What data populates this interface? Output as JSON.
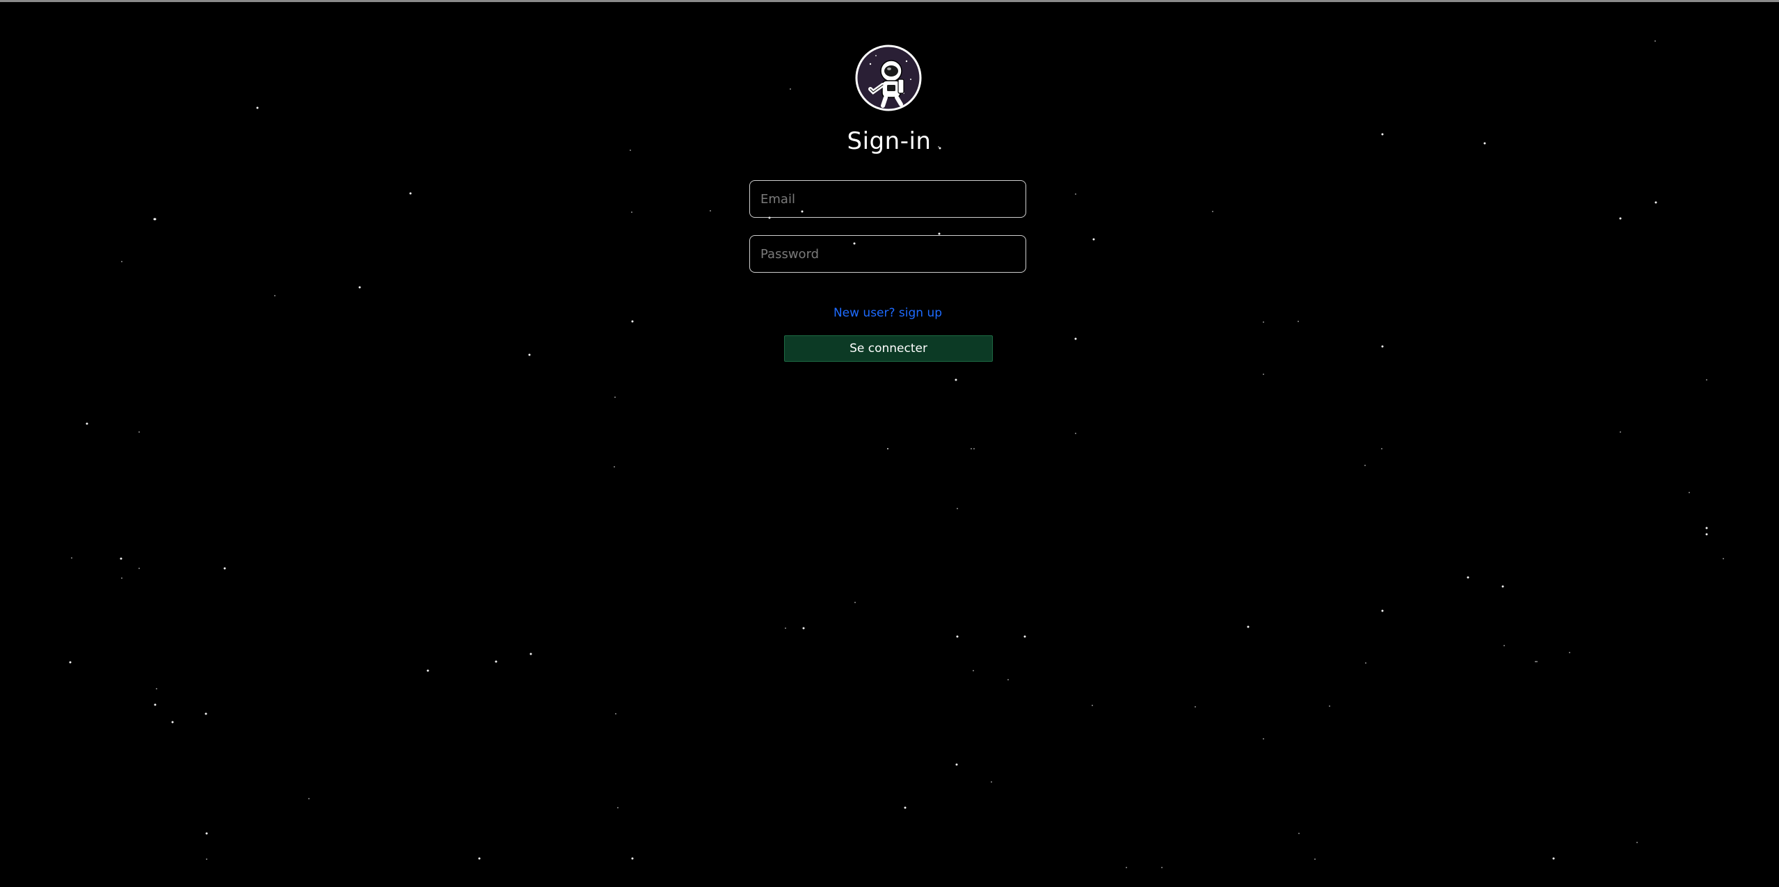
{
  "colors": {
    "background": "#000000",
    "title": "#ffffff",
    "field_border": "#cfcfcf",
    "placeholder": "#7a7a7a",
    "link": "#1e6bff",
    "button_bg": "#0c3a25",
    "button_text": "#ffffff",
    "logo_circle": "#2a1f35"
  },
  "logo": {
    "icon": "astronaut-icon"
  },
  "login": {
    "title": "Sign-in",
    "email": {
      "placeholder": "Email",
      "value": ""
    },
    "password": {
      "placeholder": "Password",
      "value": ""
    },
    "signup_link": "New user? sign up",
    "submit_label": "Se connecter"
  }
}
